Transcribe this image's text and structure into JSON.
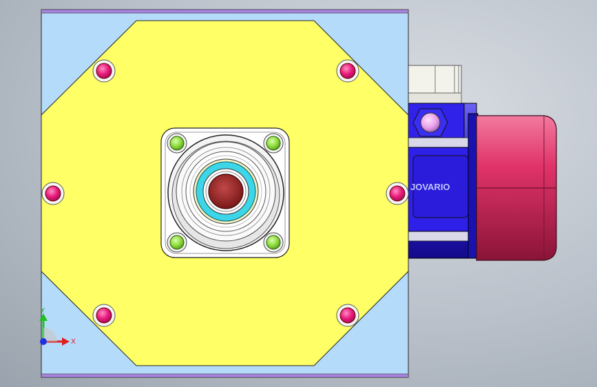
{
  "viewport": {
    "background_top": "#dcdfe4",
    "background_bottom": "#9ba4ae"
  },
  "model": {
    "motor_brand": "JOVARIO",
    "colors": {
      "base_plate": "#b4dcfa",
      "base_plate_edge": "#9a7ad6",
      "octagon_plate": "#ffff66",
      "bolt_magenta": "#e8197a",
      "bolt_green": "#8fdc3c",
      "bearing_cyan": "#3cd6e8",
      "shaft": "#9a2828",
      "motor_body": "#2a1ee0",
      "motor_cap": "#e0336a",
      "terminal_box": "#f0f0e8"
    }
  },
  "triad": {
    "x_label": "X",
    "y_label": "Y",
    "x_color": "#e02020",
    "y_color": "#20c020",
    "z_color": "#2030e0"
  }
}
